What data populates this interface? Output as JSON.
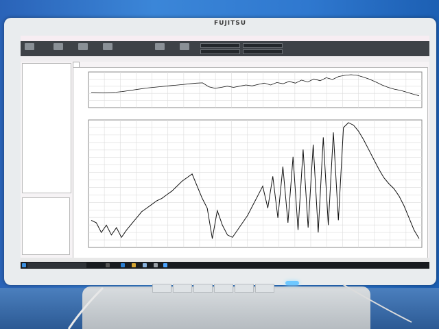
{
  "scene": {
    "monitor_brand": "FUJITSU",
    "description_colors": {
      "wall": "#2f78cf",
      "bezel": "#e9ecee",
      "power_led": "#6ec8ff"
    }
  },
  "app": {
    "title": "",
    "ribbon_labels": [
      "",
      "",
      "",
      "",
      ""
    ],
    "menu": [
      "",
      "",
      "",
      "",
      "",
      "",
      "",
      ""
    ],
    "active_tab": "",
    "sidebar_items": [
      "",
      "",
      ""
    ],
    "log_lines": [
      "",
      "",
      "",
      "",
      "",
      "",
      "",
      "",
      "",
      "",
      "",
      "",
      "",
      ""
    ]
  },
  "chart_data": [
    {
      "type": "line",
      "title": "",
      "xlabel": "",
      "ylabel": "",
      "x_ticks": [
        "",
        "",
        "",
        "",
        "",
        "",
        "",
        "",
        "",
        "",
        "",
        "",
        "",
        "",
        "",
        "",
        "",
        "",
        "",
        "",
        ""
      ],
      "y_ticks": [
        "",
        "",
        "",
        "",
        ""
      ],
      "series": [
        {
          "values": [
            0.42,
            0.41,
            0.4,
            0.41,
            0.42,
            0.44,
            0.47,
            0.5,
            0.53,
            0.56,
            0.58,
            0.6,
            0.62,
            0.64,
            0.66,
            0.68,
            0.7,
            0.72,
            0.73,
            0.6,
            0.55,
            0.58,
            0.62,
            0.58,
            0.62,
            0.66,
            0.63,
            0.68,
            0.72,
            0.66,
            0.74,
            0.7,
            0.78,
            0.72,
            0.82,
            0.76,
            0.86,
            0.8,
            0.9,
            0.84,
            0.94,
            0.98,
            1.0,
            0.98,
            0.92,
            0.85,
            0.76,
            0.66,
            0.58,
            0.52,
            0.48,
            0.42,
            0.36,
            0.3
          ]
        }
      ],
      "grid": true
    },
    {
      "type": "line",
      "title": "",
      "xlabel": "",
      "ylabel": "",
      "x_ticks": [
        "",
        "",
        "",
        "",
        "",
        "",
        "",
        "",
        "",
        "",
        "",
        "",
        "",
        "",
        "",
        "",
        "",
        "",
        "",
        "",
        ""
      ],
      "y_ticks": [
        "",
        "",
        "",
        "",
        "",
        "",
        "",
        "",
        "",
        "",
        "",
        "",
        "",
        "",
        "",
        "",
        ""
      ],
      "series": [
        {
          "values": [
            0.2,
            0.18,
            0.1,
            0.16,
            0.08,
            0.14,
            0.06,
            0.12,
            0.17,
            0.22,
            0.27,
            0.3,
            0.33,
            0.36,
            0.38,
            0.41,
            0.44,
            0.48,
            0.52,
            0.55,
            0.58,
            0.48,
            0.38,
            0.3,
            0.05,
            0.28,
            0.16,
            0.08,
            0.06,
            0.12,
            0.18,
            0.24,
            0.32,
            0.4,
            0.48,
            0.3,
            0.56,
            0.22,
            0.64,
            0.18,
            0.72,
            0.12,
            0.78,
            0.14,
            0.82,
            0.1,
            0.88,
            0.16,
            0.92,
            0.2,
            0.96,
            1.0,
            0.98,
            0.93,
            0.86,
            0.78,
            0.7,
            0.62,
            0.55,
            0.5,
            0.46,
            0.4,
            0.32,
            0.22,
            0.12,
            0.05
          ]
        }
      ],
      "grid": true
    }
  ],
  "taskbar": {
    "search_placeholder": "",
    "clock": ""
  },
  "front_buttons": [
    "",
    "",
    "",
    "",
    "",
    "",
    ""
  ]
}
